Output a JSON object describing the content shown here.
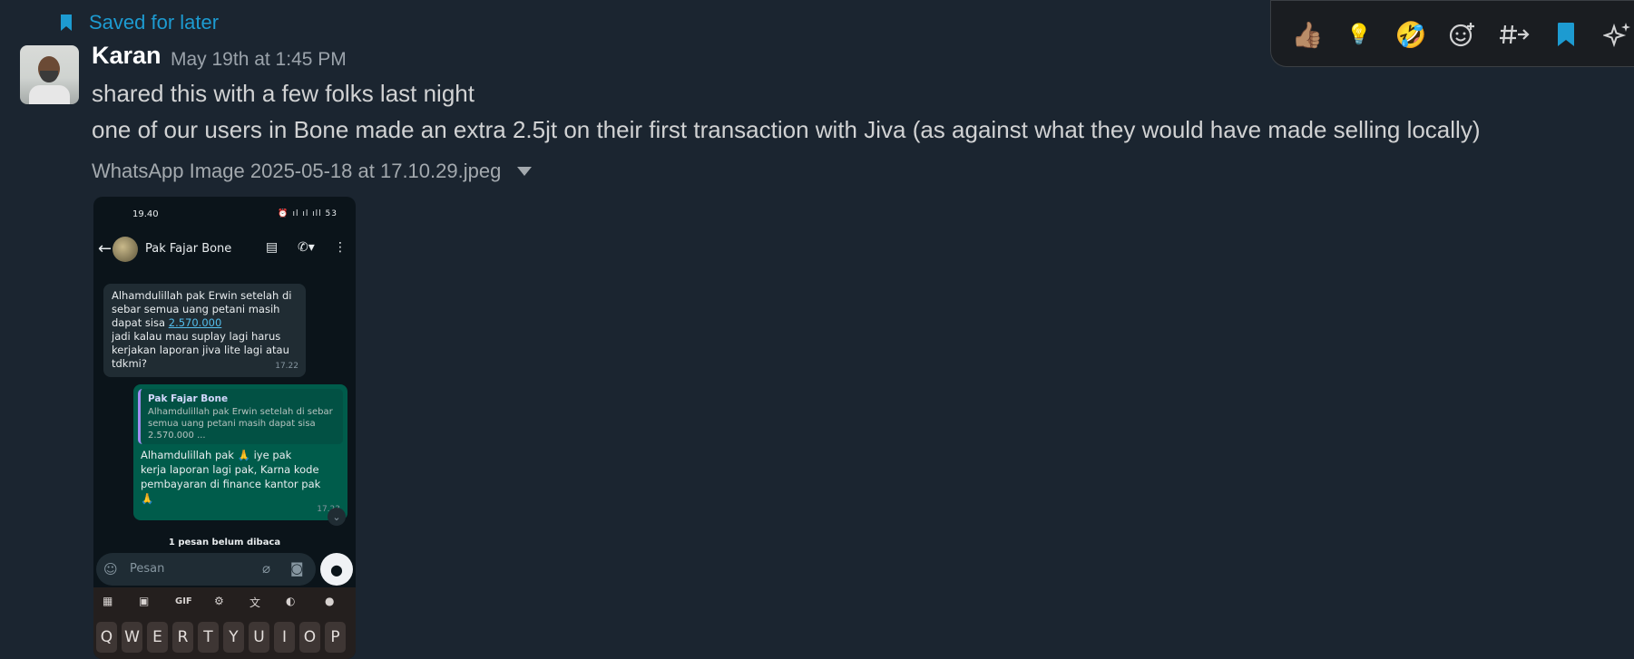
{
  "saved": {
    "label": "Saved for later"
  },
  "message": {
    "author": "Karan",
    "timestamp": "May 19th at 1:45 PM",
    "lines": [
      "shared this with a few folks last night",
      "one of our users in Bone made an extra 2.5jt on their first transaction with Jiva (as against what they would have made selling locally)"
    ]
  },
  "attachment": {
    "filename": "WhatsApp Image 2025-05-18 at 17.10.29.jpeg"
  },
  "toolbar": {
    "actions": [
      {
        "name": "thumbs-up-reaction",
        "glyph": "👍🏽"
      },
      {
        "name": "lightbulb-reaction",
        "glyph": "💡"
      },
      {
        "name": "rofl-reaction",
        "glyph": "🤣"
      },
      {
        "name": "add-reaction",
        "glyph": "☺"
      },
      {
        "name": "reply-in-channel",
        "glyph": "#→"
      },
      {
        "name": "bookmark",
        "glyph": "bookmark"
      },
      {
        "name": "ai-actions",
        "glyph": "✦"
      }
    ]
  },
  "screenshot": {
    "clock": "19.40",
    "status_icons": "⏰ ıl ıl ıll 53",
    "contact": "Pak Fajar Bone",
    "incoming": {
      "line1": "Alhamdulillah pak Erwin setelah di",
      "line2": "sebar semua uang petani masih",
      "line3_prefix": "dapat sisa ",
      "amount": "2.570.000",
      "line4": "jadi kalau mau suplay lagi harus",
      "line5": "kerjakan laporan jiva lite lagi atau",
      "line6": "tdkmi?",
      "time": "17.22"
    },
    "outgoing": {
      "quote_name": "Pak Fajar Bone",
      "quote_text": "Alhamdulillah pak Erwin setelah di sebar semua uang petani masih dapat sisa 2.570.000 ...",
      "line1": "Alhamdulillah pak 🙏 iye pak",
      "line2": "kerja laporan lagi pak, Karna kode",
      "line3": "pembayaran di finance kantor pak",
      "line4": "🙏",
      "time": "17.23"
    },
    "unread": "1 pesan belum dibaca",
    "input_placeholder": "Pesan",
    "keyboard_gif": "GIF",
    "keys": [
      "Q",
      "W",
      "E",
      "R",
      "T",
      "Y",
      "U",
      "I",
      "O",
      "P"
    ]
  },
  "colors": {
    "accent": "#1d9bd1",
    "background": "#1b2530",
    "wa_out": "#005c4b",
    "wa_in": "#202c33"
  }
}
